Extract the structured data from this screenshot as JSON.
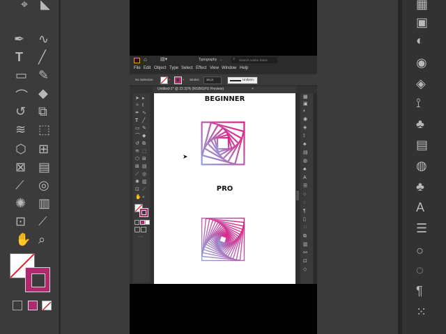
{
  "app": {
    "workspace_label": "Typography",
    "search_placeholder": "Search Adobe Stock",
    "menu": [
      "File",
      "Edit",
      "Object",
      "Type",
      "Select",
      "Effect",
      "View",
      "Window",
      "Help"
    ],
    "control_bar": {
      "selection_label": "No Selection",
      "stroke_label": "Stroke:",
      "stroke_value": "26 pt",
      "profile_label": "Uniform"
    },
    "document_tab": {
      "title": "Untitled-1* @ 22.32% (RGB/GPU Preview)",
      "close_glyph": "×"
    }
  },
  "artboard": {
    "beginner_label": "BEGINNER",
    "pro_label": "PRO"
  },
  "colors": {
    "gradient_pink": "#e8197f",
    "gradient_blue": "#8fa0d8",
    "ui_dark": "#323232",
    "canvas": "#ffffff"
  },
  "icons": {
    "left_panel": [
      "selection-icon",
      "direct-selection-icon",
      "pen-icon",
      "curvature-icon",
      "type-icon",
      "line-icon",
      "rectangle-icon",
      "paintbrush-icon",
      "shaper-icon",
      "eraser-icon",
      "rotate-icon",
      "scale-icon",
      "width-icon",
      "free-transform-icon",
      "shape-builder-icon",
      "perspective-icon",
      "mesh-icon",
      "gradient-icon",
      "eyedropper-icon",
      "blend-icon",
      "symbol-sprayer-icon",
      "graph-icon",
      "artboard-icon",
      "slice-icon",
      "hand-icon",
      "zoom-icon"
    ],
    "right_panel": [
      "swatches-icon",
      "color-icon",
      "gradient-panel-icon",
      "transparency-icon",
      "layers-icon",
      "libraries-icon",
      "symbols-icon",
      "graphic-styles-icon",
      "appearance-icon",
      "brushes-icon",
      "align-icon",
      "pathfinder-icon",
      "character-icon",
      "opentype-icon",
      "paragraph-icon",
      "clipboard-icon",
      "navigator-icon"
    ]
  }
}
